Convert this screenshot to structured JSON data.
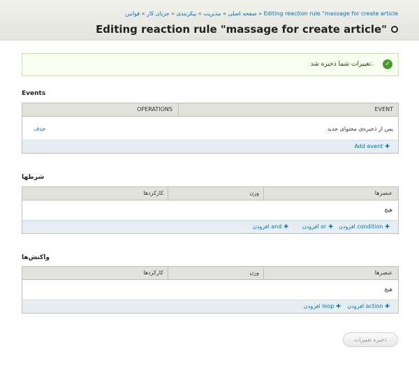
{
  "header": {
    "breadcrumb": [
      "صفحه اصلی",
      "مدیریت",
      "پیکربندی",
      "جریان کار",
      "قوانین",
      "Editing reaction rule \"massage for create article"
    ],
    "breadcrumb_separator": "»",
    "title": "Editing reaction rule \"massage for create article\""
  },
  "message": {
    "text": "تغییرات شما ذخیره شد."
  },
  "events": {
    "title": "Events",
    "columns": [
      "EVENT",
      "OPERATIONS"
    ],
    "rows": [
      {
        "event": "پس از ذخیره‌ی محتوای جدید",
        "operation": "حذف"
      }
    ],
    "add_label": "Add event"
  },
  "conditions": {
    "title": "شرطها",
    "columns": [
      "عنصرها",
      "وزن",
      "کارکردها"
    ],
    "empty": "هیچ",
    "actions": [
      "افزودن condition",
      "افزودن or",
      "افزودن and"
    ]
  },
  "reactions": {
    "title": "واکنش‌ها",
    "columns": [
      "عنصرها",
      "وزن",
      "کارکردها"
    ],
    "empty": "هیچ",
    "actions": [
      "افزودن action",
      "افزودن loop"
    ]
  },
  "save_label": "ذخیره تغییرات",
  "colors": {
    "link": "#0074bd",
    "success": "#4c9a2a",
    "header_bg": "#e4e3dd"
  }
}
